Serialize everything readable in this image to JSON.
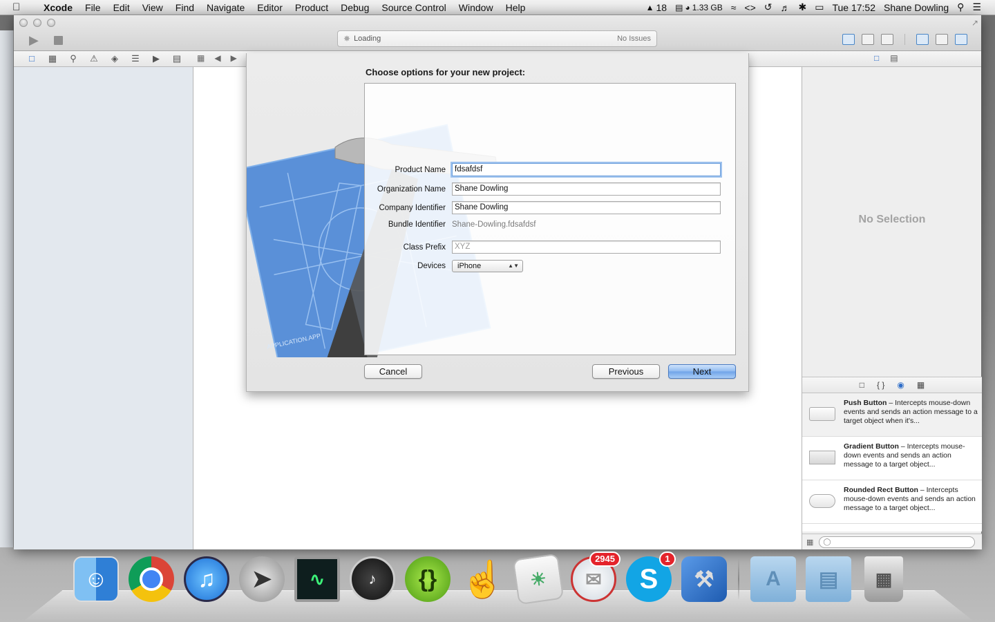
{
  "menubar": {
    "app": "Xcode",
    "items": [
      "File",
      "Edit",
      "View",
      "Find",
      "Navigate",
      "Editor",
      "Product",
      "Debug",
      "Source Control",
      "Window",
      "Help"
    ],
    "adobe_count": "18",
    "memory": "1.33 GB",
    "clock": "Tue 17:52",
    "user": "Shane Dowling"
  },
  "toolbar": {
    "activity_text": "Loading",
    "issues_text": "No Issues"
  },
  "inspector": {
    "no_selection": "No Selection"
  },
  "library": {
    "items": [
      {
        "name": "Push Button",
        "desc": "– Intercepts mouse-down events and sends an action message to a target object when it's..."
      },
      {
        "name": "Gradient Button",
        "desc": "– Intercepts mouse-down events and sends an action message to a target object..."
      },
      {
        "name": "Rounded Rect Button",
        "desc": "– Intercepts mouse-down events and sends an action message to a target object..."
      }
    ]
  },
  "sheet": {
    "title": "Choose options for your new project:",
    "fields": {
      "product_name": {
        "label": "Product Name",
        "value": "fdsafdsf"
      },
      "organization_name": {
        "label": "Organization Name",
        "value": "Shane Dowling"
      },
      "company_identifier": {
        "label": "Company Identifier",
        "value": "Shane Dowling"
      },
      "bundle_identifier": {
        "label": "Bundle Identifier",
        "value": "Shane-Dowling.fdsafdsf"
      },
      "class_prefix": {
        "label": "Class Prefix",
        "placeholder": "XYZ"
      },
      "devices": {
        "label": "Devices",
        "value": "iPhone"
      }
    },
    "buttons": {
      "cancel": "Cancel",
      "previous": "Previous",
      "next": "Next"
    },
    "artwork_text": "APPLICATION.APP"
  },
  "dock": {
    "mail_badge": "2945",
    "skype_badge": "1"
  },
  "colors": {
    "accent": "#2f6ec8",
    "badge": "#e4232b"
  }
}
